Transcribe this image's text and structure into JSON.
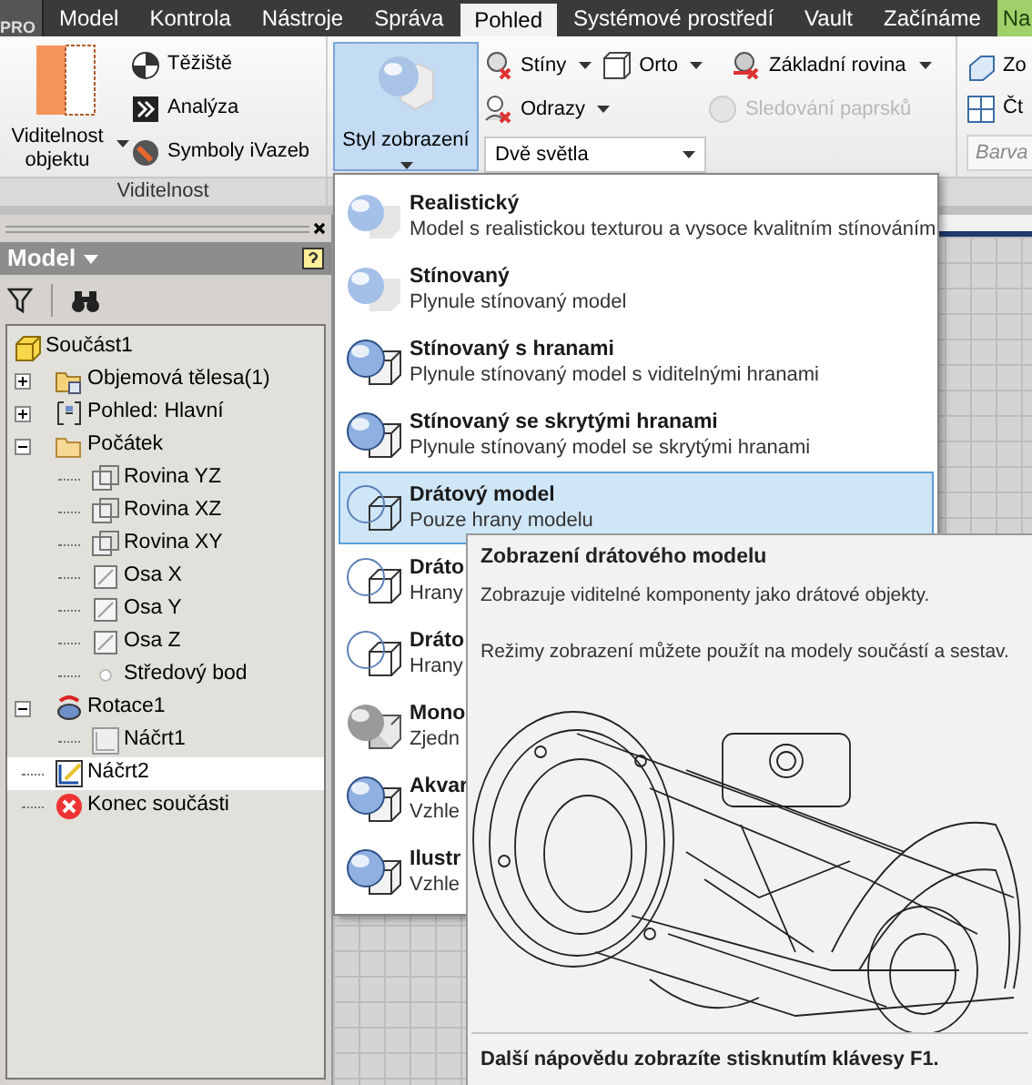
{
  "app_button": {
    "label": "PRO"
  },
  "tabs": [
    {
      "label": "Model",
      "selected": false
    },
    {
      "label": "Kontrola",
      "selected": false
    },
    {
      "label": "Nástroje",
      "selected": false
    },
    {
      "label": "Správa",
      "selected": false
    },
    {
      "label": "Pohled",
      "selected": true
    },
    {
      "label": "Systémové prostředí",
      "selected": false
    },
    {
      "label": "Vault",
      "selected": false
    },
    {
      "label": "Začínáme",
      "selected": false
    },
    {
      "label": "Na",
      "selected": false,
      "kind": "addin"
    }
  ],
  "visibility_panel": {
    "large_button": "Viditelnost objektu",
    "buttons": [
      {
        "label": "Těžiště",
        "kind": "centroid"
      },
      {
        "label": "Analýza",
        "kind": "analysis"
      },
      {
        "label": "Symboly iVazeb",
        "kind": "constraint"
      }
    ],
    "label": "Viditelnost"
  },
  "style_button": {
    "label": "Styl zobrazení",
    "pressed": true
  },
  "appearance_buttons": [
    {
      "label": "Stíny",
      "kind": "shadow",
      "dropdown": true,
      "disabled": false
    },
    {
      "label": "Orto",
      "kind": "ortho",
      "dropdown": true,
      "disabled": false
    },
    {
      "label": "Základní rovina",
      "kind": "ground",
      "dropdown": true,
      "disabled": false
    },
    {
      "label": "Odrazy",
      "kind": "reflect",
      "dropdown": true,
      "disabled": false
    },
    {
      "label": "Sledování paprsků",
      "kind": "ray",
      "dropdown": false,
      "disabled": true
    }
  ],
  "lighting_dropdown": {
    "value": "Dvě světla"
  },
  "cut_buttons": [
    "Zo",
    "Čt"
  ],
  "color_field": {
    "placeholder": "Barva"
  },
  "browser": {
    "title": "Model",
    "tree": [
      {
        "label": "Součást1",
        "kind": "part",
        "selected": false,
        "children": [
          {
            "label": "Objemová tělesa(1)",
            "kind": "bodies",
            "selected": false,
            "expanded": false
          },
          {
            "label": "Pohled: Hlavní",
            "kind": "view",
            "selected": false,
            "expanded": false
          },
          {
            "label": "Počátek",
            "kind": "folder",
            "selected": false,
            "expanded": true,
            "children": [
              {
                "label": "Rovina YZ",
                "kind": "plane",
                "selected": false
              },
              {
                "label": "Rovina XZ",
                "kind": "plane",
                "selected": false
              },
              {
                "label": "Rovina XY",
                "kind": "plane",
                "selected": false
              },
              {
                "label": "Osa X",
                "kind": "axis",
                "selected": false
              },
              {
                "label": "Osa Y",
                "kind": "axis",
                "selected": false
              },
              {
                "label": "Osa Z",
                "kind": "axis",
                "selected": false
              },
              {
                "label": "Středový bod",
                "kind": "point",
                "selected": false
              }
            ]
          },
          {
            "label": "Rotace1",
            "kind": "revolve",
            "selected": false,
            "expanded": true,
            "children": [
              {
                "label": "Náčrt1",
                "kind": "sketch_off",
                "selected": false
              }
            ]
          },
          {
            "label": "Náčrt2",
            "kind": "sketch",
            "selected": true
          },
          {
            "label": "Konec součásti",
            "kind": "end",
            "selected": false
          }
        ]
      }
    ]
  },
  "style_menu": {
    "items": [
      {
        "title": "Realistický",
        "description": "Model s realistickou texturou a vysoce kvalitním stínováním",
        "kind": "shaded",
        "selected": false
      },
      {
        "title": "Stínovaný",
        "description": "Plynule stínovaný model",
        "kind": "shaded",
        "selected": false
      },
      {
        "title": "Stínovaný s hranami",
        "description": "Plynule stínovaný model s viditelnými hranami",
        "kind": "edged",
        "selected": false
      },
      {
        "title": "Stínovaný se skrytými hranami",
        "description": "Plynule stínovaný model se skrytými hranami",
        "kind": "edged",
        "selected": false
      },
      {
        "title": "Drátový model",
        "description": "Pouze hrany modelu",
        "kind": "wire",
        "selected": true
      },
      {
        "title": "Dráto",
        "description": "Hrany",
        "kind": "wire",
        "selected": false
      },
      {
        "title": "Dráto",
        "description": "Hrany",
        "kind": "wire",
        "selected": false
      },
      {
        "title": "Mono",
        "description": "Zjedn",
        "kind": "mono",
        "selected": false
      },
      {
        "title": "Akvar",
        "description": "Vzhle",
        "kind": "edged",
        "selected": false
      },
      {
        "title": "Ilustr",
        "description": "Vzhle",
        "kind": "edged",
        "selected": false
      }
    ]
  },
  "tooltip": {
    "title": "Zobrazení drátového modelu",
    "lines": [
      "Zobrazuje viditelné komponenty jako drátové objekty.",
      "Režimy zobrazení můžete použít na modely součástí a sestav."
    ],
    "footer": "Další nápovědu zobrazíte stisknutím klávesy F1."
  }
}
